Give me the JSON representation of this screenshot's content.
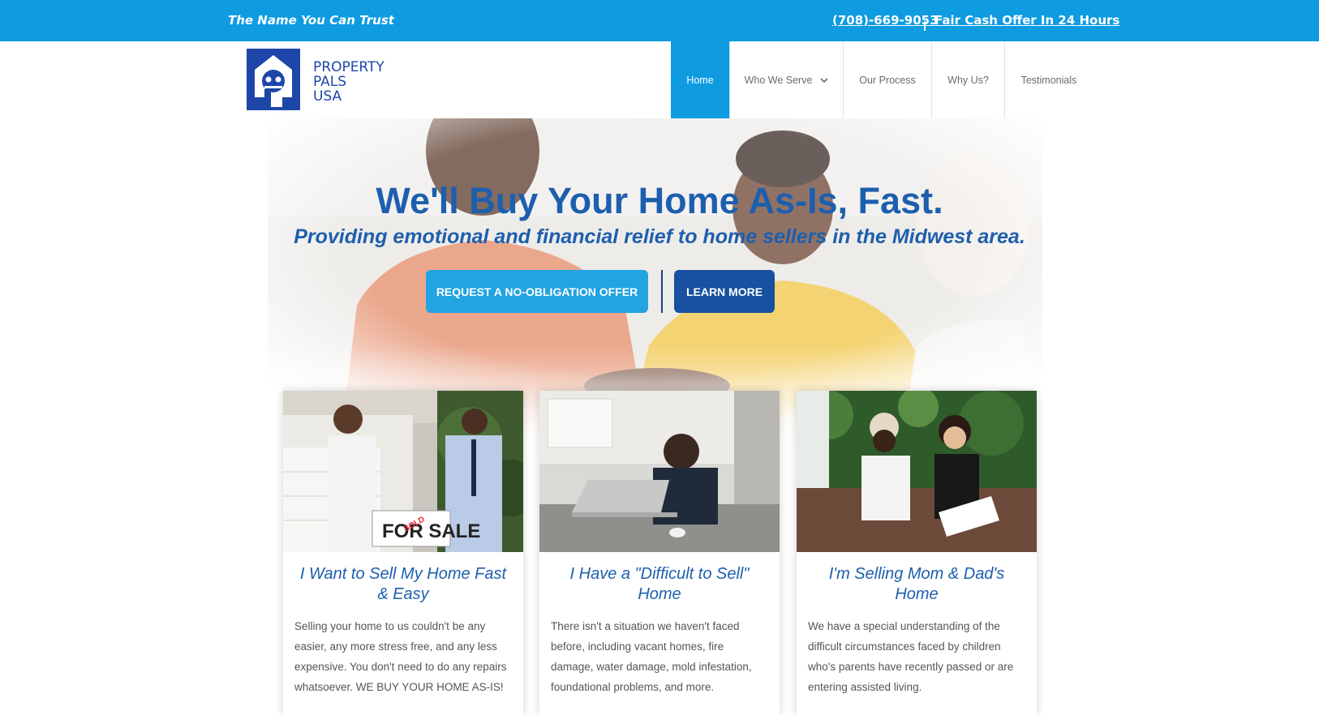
{
  "topbar": {
    "tagline": "The Name You Can Trust",
    "phone": "(708)-669-9053",
    "separator": "|",
    "cash_offer": "Fair Cash Offer In 24 Hours"
  },
  "logo": {
    "line1": "PROPERTY",
    "line2": "PALS",
    "line3": "USA"
  },
  "nav": {
    "home": "Home",
    "who_we_serve": "Who We Serve",
    "our_process": "Our Process",
    "why_us": "Why Us?",
    "testimonials": "Testimonials"
  },
  "hero": {
    "title": "We'll Buy Your Home As-Is, Fast.",
    "subtitle": "Providing emotional and financial relief to home sellers in the Midwest area.",
    "offer_button": "REQUEST A NO-OBLIGATION OFFER",
    "learn_button": "LEARN MORE"
  },
  "cards": [
    {
      "title": "I Want to Sell My Home Fast & Easy",
      "text": "Selling your home to us couldn't be any easier, any more stress free, and any less expensive. You don't need to do any repairs whatsoever. WE BUY YOUR HOME AS-IS!",
      "sign": "FOR SALE",
      "sold": "SOLD"
    },
    {
      "title": "I Have a \"Difficult to Sell\" Home",
      "text": "There isn't a situation we haven't faced before, including vacant homes, fire damage, water damage, mold infestation, foundational problems, and more."
    },
    {
      "title": "I'm Selling Mom & Dad's Home",
      "text": "We have a special understanding of the difficult circumstances faced by children who's parents have recently passed or are entering assisted living."
    }
  ],
  "colors": {
    "topbar": "#0e9be0",
    "brand_blue": "#1d5fae",
    "logo_blue": "#1e46a9",
    "learn_button": "#1751a0",
    "offer_button": "#22a3e2"
  }
}
